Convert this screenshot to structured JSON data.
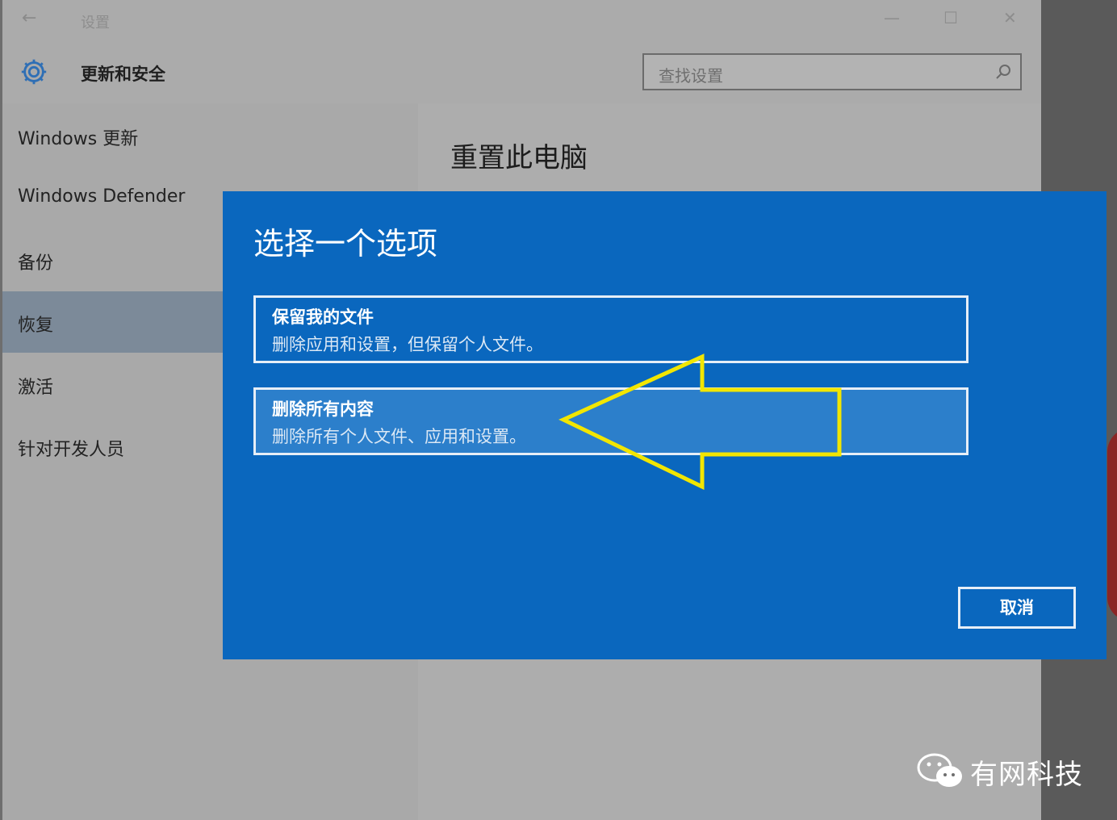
{
  "window": {
    "title": "设置",
    "back_glyph": "←",
    "minimize_glyph": "—",
    "maximize_glyph": "☐",
    "close_glyph": "✕"
  },
  "header": {
    "section_title": "更新和安全",
    "search_placeholder": "查找设置"
  },
  "sidebar": {
    "items": [
      {
        "label": "Windows 更新"
      },
      {
        "label": "Windows Defender"
      },
      {
        "label": "备份"
      },
      {
        "label": "恢复"
      },
      {
        "label": "激活"
      },
      {
        "label": "针对开发人员"
      }
    ],
    "active_index": 3
  },
  "content": {
    "page_title": "重置此电脑"
  },
  "dialog": {
    "title": "选择一个选项",
    "options": [
      {
        "title": "保留我的文件",
        "description": "删除应用和设置，但保留个人文件。"
      },
      {
        "title": "删除所有内容",
        "description": "删除所有个人文件、应用和设置。"
      }
    ],
    "cancel_label": "取消"
  },
  "annotation": {
    "shape": "arrow-left",
    "color": "#f2e600"
  },
  "watermark": {
    "text": "有网科技",
    "icon": "wechat-icon"
  },
  "colors": {
    "dialog_bg": "#0a67be",
    "sidebar_active": "#7c8a99"
  }
}
